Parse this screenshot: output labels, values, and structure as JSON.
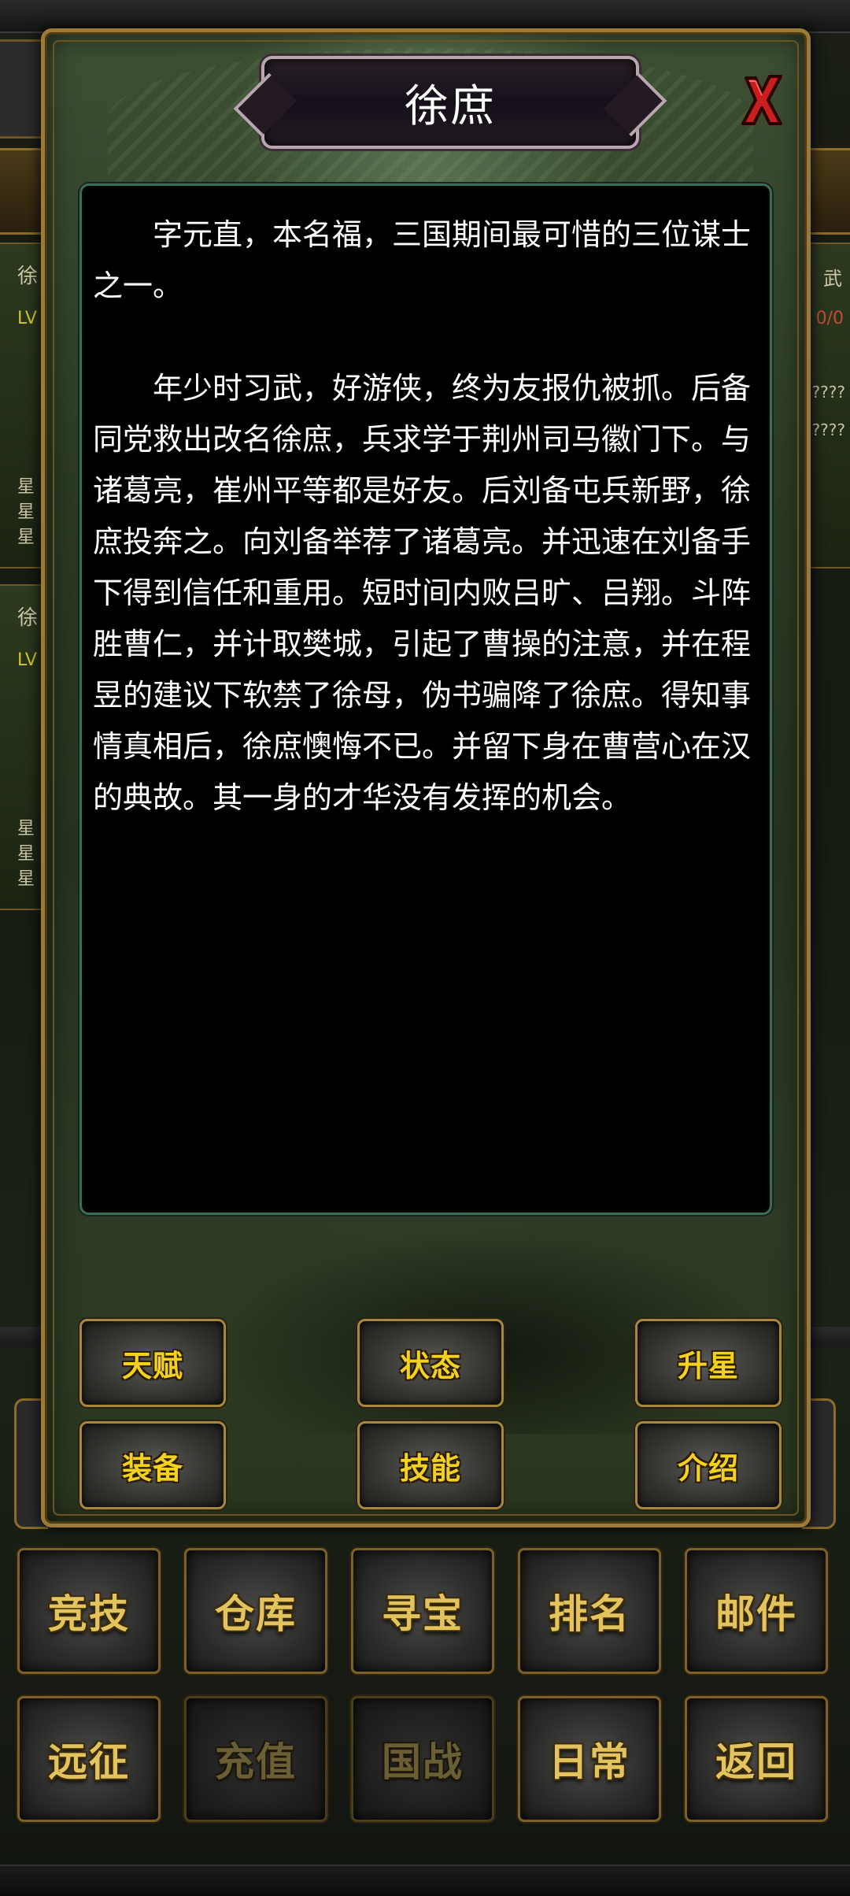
{
  "background": {
    "left_cards": [
      {
        "name_char": "徐",
        "lv": "LV",
        "stars": [
          "星",
          "星",
          "星"
        ]
      },
      {
        "name_char": "徐",
        "lv": "LV",
        "stars": [
          "星",
          "星",
          "星"
        ]
      }
    ],
    "right_card": {
      "label": "武",
      "value": "0/0",
      "q1": "????",
      "q2": "????"
    }
  },
  "modal": {
    "title": "徐庶",
    "close_label": "X",
    "description": {
      "paragraph1": "字元直，本名福，三国期间最可惜的三位谋士之一。",
      "paragraph2": "年少时习武，好游侠，终为友报仇被抓。后备同党救出改名徐庶，兵求学于荆州司马徽门下。与诸葛亮，崔州平等都是好友。后刘备屯兵新野，徐庶投奔之。向刘备举荐了诸葛亮。并迅速在刘备手下得到信任和重用。短时间内败吕旷、吕翔。斗阵胜曹仁，并计取樊城，引起了曹操的注意，并在程昱的建议下软禁了徐母，伪书骗降了徐庶。得知事情真相后，徐庶懊悔不已。并留下身在曹营心在汉的典故。其一身的才华没有发挥的机会。"
    },
    "tabs": {
      "talent": "天赋",
      "status": "状态",
      "star_up": "升星",
      "equipment": "装备",
      "skill": "技能",
      "intro": "介绍"
    }
  },
  "menu": {
    "row1": [
      "竞技",
      "仓库",
      "寻宝",
      "排名",
      "邮件"
    ],
    "row2": [
      "远征",
      "充值",
      "国战",
      "日常",
      "返回"
    ]
  },
  "colors": {
    "accent_gold": "#e2c35e",
    "tab_text_yellow": "#f2d21d",
    "close_red": "#c81e1e"
  }
}
